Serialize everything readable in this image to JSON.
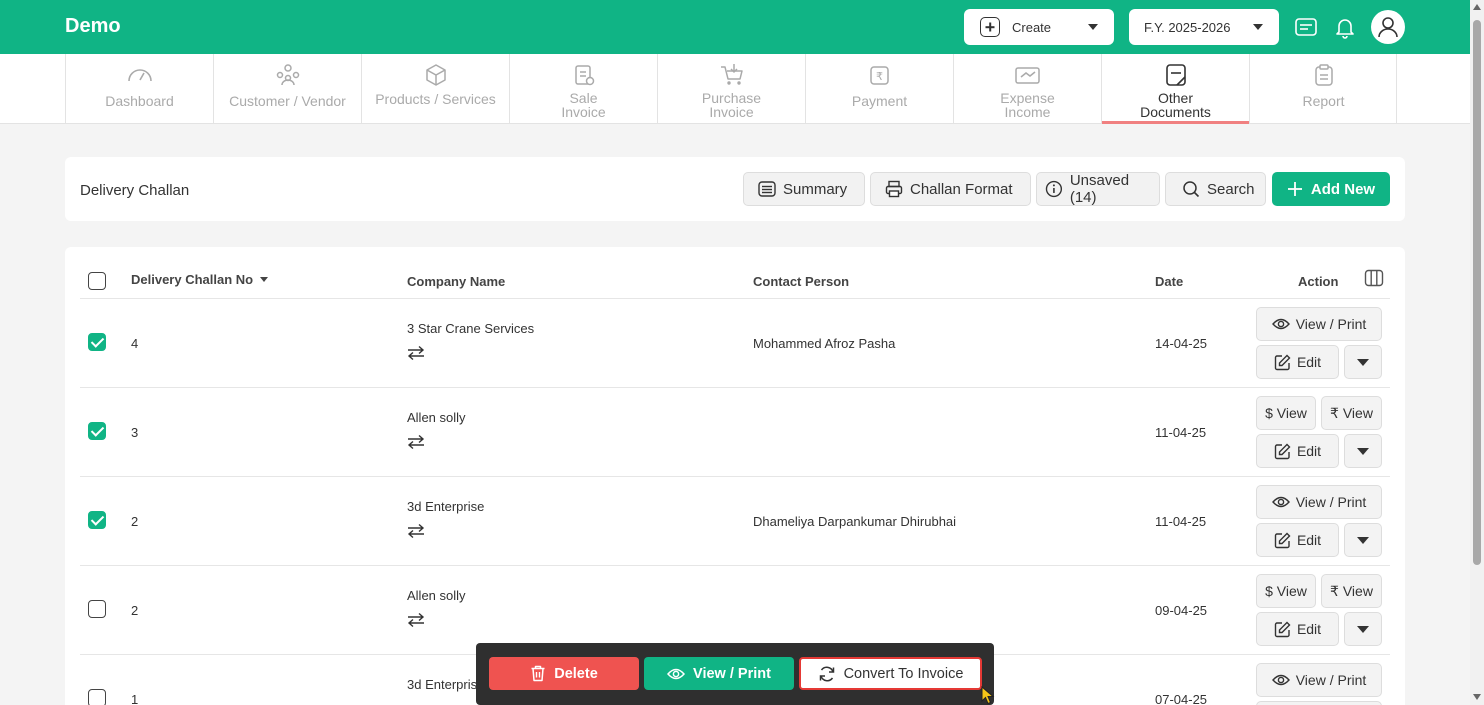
{
  "app": {
    "brand": "Demo"
  },
  "topbar": {
    "create_label": "Create",
    "fy_label": "F.Y. 2025-2026"
  },
  "nav": {
    "tabs": [
      {
        "label": "Dashboard",
        "icon": "gauge-icon"
      },
      {
        "label": "Customer / Vendor",
        "icon": "users-icon"
      },
      {
        "label": "Products / Services",
        "icon": "box-icon"
      },
      {
        "label": "Sale\nInvoice",
        "icon": "sale-invoice-icon"
      },
      {
        "label": "Purchase\nInvoice",
        "icon": "cart-icon"
      },
      {
        "label": "Payment",
        "icon": "rupee-payment-icon"
      },
      {
        "label": "Expense\nIncome",
        "icon": "expense-icon"
      },
      {
        "label": "Other\nDocuments",
        "icon": "document-icon",
        "active": true
      },
      {
        "label": "Report",
        "icon": "clipboard-icon"
      }
    ]
  },
  "page": {
    "title": "Delivery Challan",
    "buttons": {
      "summary": "Summary",
      "challan_format": "Challan Format",
      "unsaved": "Unsaved (14)",
      "search": "Search",
      "add_new": "Add New"
    }
  },
  "table": {
    "headers": {
      "challan_no": "Delivery Challan No",
      "company": "Company Name",
      "contact": "Contact Person",
      "date": "Date",
      "action": "Action"
    },
    "rows": [
      {
        "checked": true,
        "no": "4",
        "company": "3 Star Crane Services",
        "contact": "Mohammed Afroz Pasha",
        "date": "14-04-25",
        "view_type": "print"
      },
      {
        "checked": true,
        "no": "3",
        "company": "Allen solly",
        "contact": "",
        "date": "11-04-25",
        "view_type": "currency"
      },
      {
        "checked": true,
        "no": "2",
        "company": "3d Enterprise",
        "contact": "Dhameliya Darpankumar Dhirubhai",
        "date": "11-04-25",
        "view_type": "print"
      },
      {
        "checked": false,
        "no": "2",
        "company": "Allen solly",
        "contact": "",
        "date": "09-04-25",
        "view_type": "currency"
      },
      {
        "checked": false,
        "no": "1",
        "company": "3d Enterprise",
        "contact": "",
        "date": "07-04-25",
        "view_type": "print"
      }
    ],
    "labels": {
      "view_print": "View / Print",
      "edit": "Edit",
      "usd_view": "$ View",
      "inr_view": "₹ View"
    }
  },
  "action_bar": {
    "delete": "Delete",
    "view_print": "View / Print",
    "convert": "Convert To Invoice"
  },
  "colors": {
    "brand_green": "#10b485",
    "danger_red": "#ef5350",
    "active_tab_underline": "#f08080"
  }
}
